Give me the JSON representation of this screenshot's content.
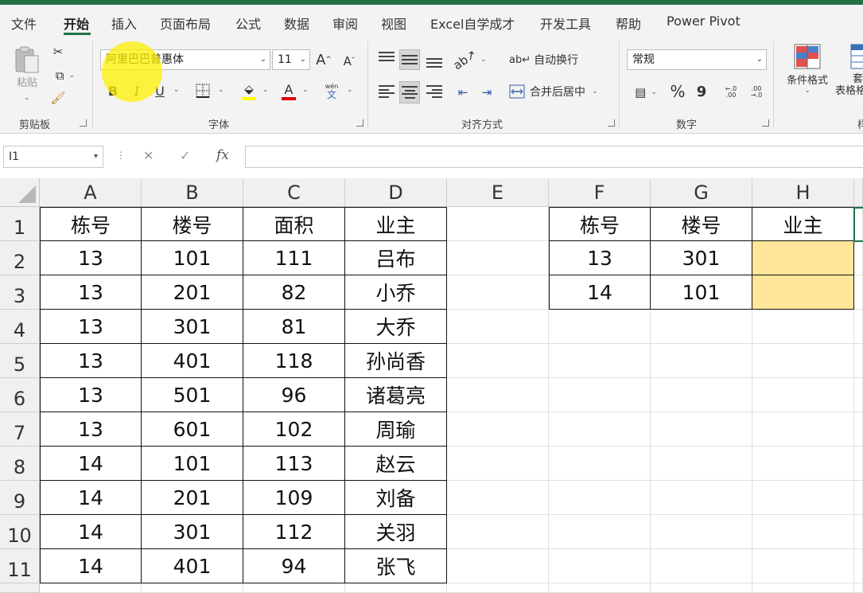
{
  "colors": {
    "accent": "#217346",
    "fill_yellow": "#ffe699",
    "highlight": "#fff000"
  },
  "tabs": [
    "文件",
    "开始",
    "插入",
    "页面布局",
    "公式",
    "数据",
    "审阅",
    "视图",
    "Excel自学成才",
    "开发工具",
    "帮助",
    "Power Pivot"
  ],
  "active_tab": "开始",
  "ribbon": {
    "clipboard": {
      "paste_label": "粘贴",
      "group_label": "剪贴板"
    },
    "font": {
      "font_name": "阿里巴巴普惠体",
      "font_size": "11",
      "grow_label": "A",
      "shrink_label": "A",
      "bold": "B",
      "italic": "I",
      "underline": "U",
      "font_color_label": "A",
      "phonetic_top": "wén",
      "phonetic_bottom": "文",
      "group_label": "字体"
    },
    "alignment": {
      "wrap_text": "自动换行",
      "merge_center": "合并后居中",
      "group_label": "对齐方式"
    },
    "number": {
      "format": "常规",
      "percent": "%",
      "comma": "9",
      "increase_decimal": "←.0 .00",
      "decrease_decimal": ".00 →.0",
      "group_label": "数字"
    },
    "styles": {
      "conditional_formatting": "条件格式",
      "table_format_top": "套",
      "table_format_bottom": "表格格",
      "group_label_partial": "样"
    }
  },
  "formula_bar": {
    "name_box": "I1",
    "cancel": "✕",
    "enter": "✓",
    "fx": "fx",
    "value": ""
  },
  "columns": [
    "A",
    "B",
    "C",
    "D",
    "E",
    "F",
    "G",
    "H"
  ],
  "rows": [
    "1",
    "2",
    "3",
    "4",
    "5",
    "6",
    "7",
    "8",
    "9",
    "10",
    "11"
  ],
  "table_left": {
    "headers": [
      "栋号",
      "楼号",
      "面积",
      "业主"
    ],
    "rows": [
      [
        "13",
        "101",
        "111",
        "吕布"
      ],
      [
        "13",
        "201",
        "82",
        "小乔"
      ],
      [
        "13",
        "301",
        "81",
        "大乔"
      ],
      [
        "13",
        "401",
        "118",
        "孙尚香"
      ],
      [
        "13",
        "501",
        "96",
        "诸葛亮"
      ],
      [
        "13",
        "601",
        "102",
        "周瑜"
      ],
      [
        "14",
        "101",
        "113",
        "赵云"
      ],
      [
        "14",
        "201",
        "109",
        "刘备"
      ],
      [
        "14",
        "301",
        "112",
        "关羽"
      ],
      [
        "14",
        "401",
        "94",
        "张飞"
      ]
    ]
  },
  "table_right": {
    "headers": [
      "栋号",
      "楼号",
      "业主"
    ],
    "rows": [
      [
        "13",
        "301",
        ""
      ],
      [
        "14",
        "101",
        ""
      ]
    ]
  }
}
